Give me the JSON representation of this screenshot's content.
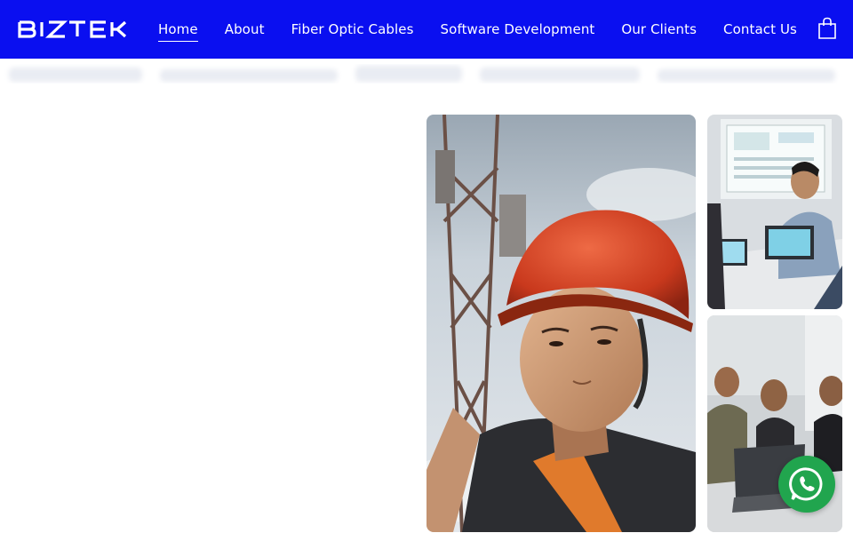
{
  "header": {
    "logo_text": "BIZTEK",
    "nav": [
      {
        "label": "Home",
        "active": true
      },
      {
        "label": "About",
        "active": false
      },
      {
        "label": "Fiber Optic Cables",
        "active": false
      },
      {
        "label": "Software Development",
        "active": false
      },
      {
        "label": "Our Clients",
        "active": false
      },
      {
        "label": "Contact Us",
        "active": false
      }
    ],
    "cart_icon": "shopping-bag-icon"
  },
  "hero": {
    "images": [
      {
        "name": "engineer-hard-hat-tower"
      },
      {
        "name": "team-meeting-presentation"
      },
      {
        "name": "team-meeting-laptops"
      }
    ]
  },
  "floating": {
    "whatsapp_icon": "whatsapp-icon"
  },
  "colors": {
    "header_bg": "#0a0ff0",
    "nav_text": "#ffffff",
    "whatsapp_green": "#21a54e"
  }
}
